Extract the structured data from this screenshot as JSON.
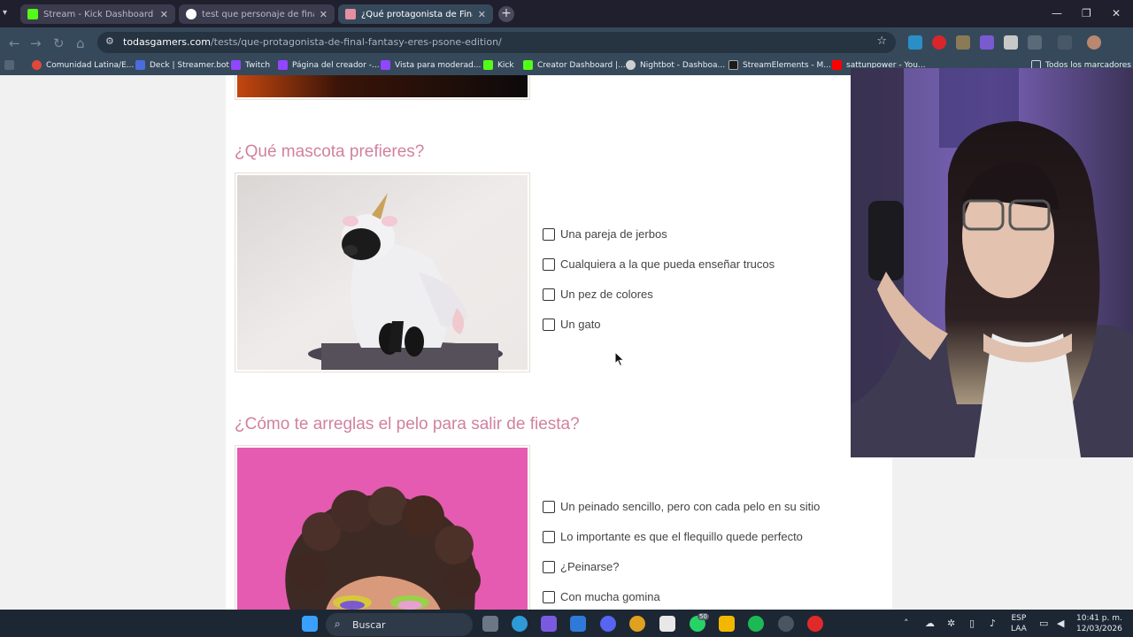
{
  "browser": {
    "tabs": [
      {
        "title": "Stream - Kick Dashboard",
        "active": false
      },
      {
        "title": "test que personaje de final fantasy",
        "active": false
      },
      {
        "title": "¿Qué protagonista de Final Fantasy",
        "active": true
      }
    ],
    "url_domain": "todasgamers.com",
    "url_path": "/tests/que-protagonista-de-final-fantasy-eres-psone-edition/",
    "bookmarks": [
      "Comunidad Latina/E...",
      "Deck | Streamer.bot",
      "Twitch",
      "Página del creador -...",
      "Vista para moderad...",
      "Kick",
      "Creator Dashboard |...",
      "Nightbot - Dashboa...",
      "StreamElements - M...",
      "sattunpower - You...",
      "Todos los marcadores"
    ]
  },
  "quiz": {
    "questions": [
      {
        "title": "¿Qué mascota prefieres?",
        "options": [
          "Una pareja de jerbos",
          "Cualquiera a la que pueda enseñar trucos",
          "Un pez de colores",
          "Un gato"
        ]
      },
      {
        "title": "¿Cómo te arreglas el pelo para salir de fiesta?",
        "options": [
          "Un peinado sencillo, pero con cada pelo en su sitio",
          "Lo importante es que el flequillo quede perfecto",
          "¿Peinarse?",
          "Con mucha gomina"
        ]
      }
    ]
  },
  "taskbar": {
    "search_placeholder": "Buscar",
    "whatsapp_badge": "50",
    "lang_top": "ESP",
    "lang_bottom": "LAA",
    "time": "10:41 p. m.",
    "date": "12/03/2026"
  },
  "colors": {
    "accent_title": "#d1819f",
    "kick_green": "#53fc18"
  }
}
